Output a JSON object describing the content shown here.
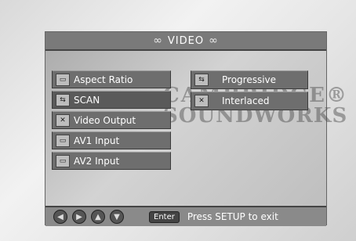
{
  "header": {
    "title": "VIDEO",
    "ornament": "∞"
  },
  "watermark": {
    "line1": "CAMBRIDGE®",
    "line2": "SOUNDWORKS"
  },
  "menu": {
    "items": [
      {
        "label": "Aspect Ratio",
        "icon": "tv-icon"
      },
      {
        "label": "SCAN",
        "icon": "scan-icon"
      },
      {
        "label": "Video Output",
        "icon": "tools-icon"
      },
      {
        "label": "AV1 Input",
        "icon": "tv-icon"
      },
      {
        "label": "AV2 Input",
        "icon": "tv-icon"
      }
    ]
  },
  "submenu": {
    "options": [
      {
        "label": "Progressive",
        "icon": "scan-icon"
      },
      {
        "label": "Interlaced",
        "icon": "tools-icon"
      }
    ]
  },
  "footer": {
    "arrows": [
      "◀",
      "▶",
      "▲",
      "▼"
    ],
    "enter": "Enter",
    "hint": "Press SETUP to exit"
  }
}
